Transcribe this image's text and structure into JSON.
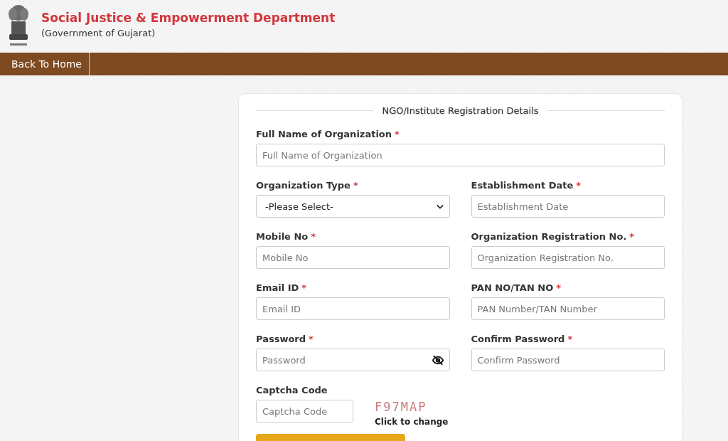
{
  "header": {
    "title": "Social Justice & Empowerment Department",
    "subtitle": "(Government of Gujarat)"
  },
  "nav": [
    {
      "label": "Back To Home"
    }
  ],
  "form": {
    "title": "NGO/Institute Registration Details",
    "required_mark": "*",
    "rows": [
      [
        {
          "kind": "text",
          "label": "Full Name of Organization",
          "required": true,
          "placeholder": "Full Name of Organization"
        }
      ],
      [
        {
          "kind": "select",
          "label": "Organization Type",
          "required": true,
          "value": "-Please Select-"
        },
        {
          "kind": "text",
          "label": "Establishment Date",
          "required": true,
          "placeholder": "Establishment Date"
        }
      ],
      [
        {
          "kind": "text",
          "label": "Mobile No",
          "required": true,
          "placeholder": "Mobile No"
        },
        {
          "kind": "text",
          "label": "Organization Registration No.",
          "required": true,
          "placeholder": "Organization Registration No."
        }
      ],
      [
        {
          "kind": "text",
          "label": "Email ID",
          "required": true,
          "placeholder": "Email ID"
        },
        {
          "kind": "text",
          "label": "PAN NO/TAN NO",
          "required": true,
          "placeholder": "PAN Number/TAN Number"
        }
      ],
      [
        {
          "kind": "password",
          "label": "Password",
          "required": true,
          "placeholder": "Password"
        },
        {
          "kind": "text",
          "label": "Confirm Password",
          "required": true,
          "placeholder": "Confirm Password"
        }
      ]
    ],
    "captcha": {
      "label": "Captcha Code",
      "placeholder": "Captcha Code",
      "code": "F97MAP",
      "hint": "Click to change"
    }
  }
}
